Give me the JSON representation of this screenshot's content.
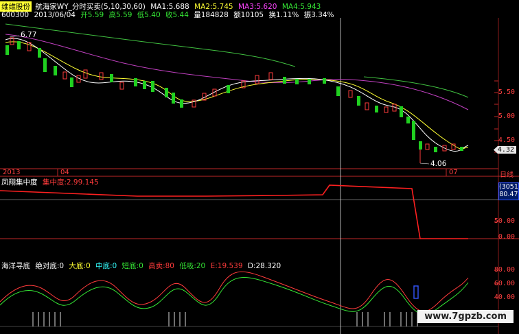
{
  "header": {
    "stock_name": "维维股份",
    "formula_name": "航海家WY_分时买卖(5,10,30,60)",
    "ma1": "MA1:5.688",
    "ma2": "MA2:5.745",
    "ma3": "MA3:5.620",
    "ma4": "MA4:5.943",
    "code": "600300",
    "date": "2013/06/04",
    "open": "开5.59",
    "high": "高5.59",
    "low": "低5.40",
    "close": "收5.44",
    "volume": "量184828",
    "amount": "额10105",
    "turnover": "换1.11%",
    "amplitude": "振3.34%"
  },
  "price_axis": {
    "ticks": [
      "5.50",
      "5.00",
      "4.50"
    ],
    "current_price": "4.32",
    "annotations": {
      "high": "6.77",
      "low": "4.06"
    }
  },
  "time_axis": {
    "labels": [
      "2013",
      "04",
      "07"
    ],
    "period": "日线"
  },
  "indicator1": {
    "name": "凤翔集中度",
    "value_label": "集中度:2.99.145",
    "axis": [
      "80.47",
      "50.00",
      "0.00"
    ],
    "box_value": "(3051)"
  },
  "indicator2": {
    "name": "海洋寻底",
    "labels": [
      {
        "text": "绝对底:0",
        "color": "#ffffff"
      },
      {
        "text": "大底:0",
        "color": "#ffff33"
      },
      {
        "text": "中底:0",
        "color": "#33ffff"
      },
      {
        "text": "短底:0",
        "color": "#35e635"
      },
      {
        "text": "高卖:80",
        "color": "#ff3b3b"
      },
      {
        "text": "低吸:20",
        "color": "#35e635"
      },
      {
        "text": "E:19.539",
        "color": "#ff3b3b"
      },
      {
        "text": "D:28.320",
        "color": "#ffffff"
      }
    ],
    "axis": [
      "80.00",
      "60.00",
      "40.00"
    ]
  },
  "footer": {
    "watermark": "www.7gpzb.com"
  },
  "colors": {
    "up": "#ff3b3b",
    "down": "#20d020",
    "grid": "#8b1a1a",
    "ma_white": "#ffffff",
    "ma_yellow": "#ffff33",
    "ma_magenta": "#c040c0",
    "ma_green": "#40c040"
  }
}
